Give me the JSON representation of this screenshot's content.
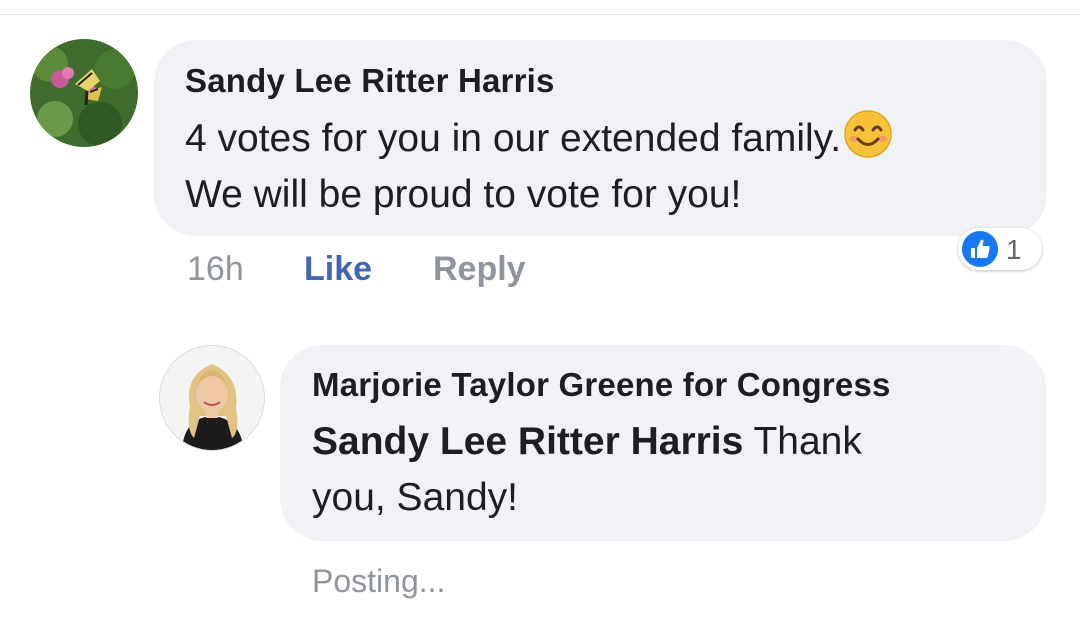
{
  "comment": {
    "author": "Sandy Lee Ritter Harris",
    "line1": "4 votes for you in our extended family.",
    "emoji": "smiling-face-icon",
    "line2": "We will be proud to vote for you!",
    "timestamp": "16h",
    "like_label": "Like",
    "reply_label": "Reply",
    "reaction_count": "1",
    "reaction_icon": "thumbs-up-icon"
  },
  "reply": {
    "author": "Marjorie Taylor Greene for Congress",
    "mention": "Sandy Lee Ritter Harris",
    "text_part1": "Thank",
    "text_part2": "you, Sandy!",
    "status": "Posting..."
  },
  "colors": {
    "bubble": "#f0f2f5",
    "link": "#4267b2",
    "muted": "#90949c",
    "text": "#1c1e21",
    "reaction_blue": "#1877f2"
  }
}
